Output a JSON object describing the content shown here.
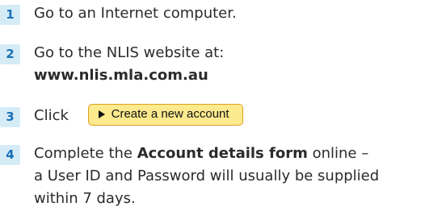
{
  "steps": [
    {
      "number": "1",
      "text": "Go to an Internet computer."
    },
    {
      "number": "2",
      "line1": "Go to the NLIS website at:",
      "url": "www.nlis.mla.com.au"
    },
    {
      "number": "3",
      "prefix": "Click",
      "button_label": "Create a new account"
    },
    {
      "number": "4",
      "line1_prefix": "Complete the ",
      "line1_bold": "Account details form",
      "line1_suffix": " online –",
      "line2": "a User ID and Password will usually be supplied",
      "line3": "within 7 days."
    }
  ],
  "colors": {
    "badge_background": "#d5ecf7",
    "badge_text": "#1a70b6",
    "button_background": "#fdea8e",
    "button_border": "#e0a01a"
  }
}
